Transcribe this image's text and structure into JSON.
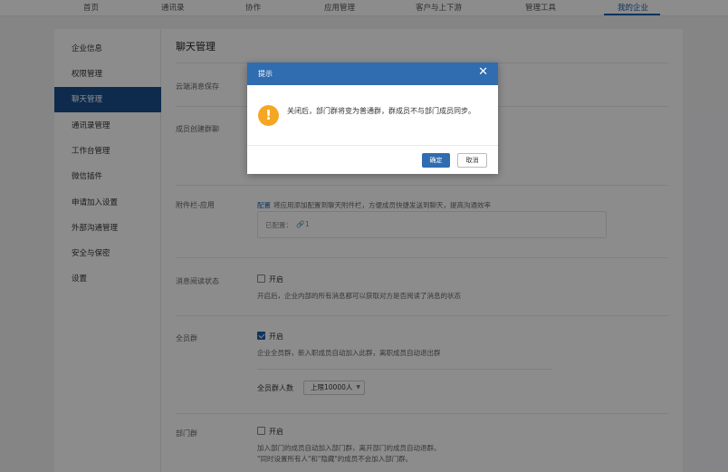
{
  "topnav": {
    "tabs": [
      {
        "label": "首页",
        "active": false
      },
      {
        "label": "通讯录",
        "active": false
      },
      {
        "label": "协作",
        "active": false
      },
      {
        "label": "应用管理",
        "active": false
      },
      {
        "label": "客户与上下游",
        "active": false
      },
      {
        "label": "管理工具",
        "active": false
      },
      {
        "label": "我的企业",
        "active": true
      }
    ]
  },
  "sidebar": {
    "items": [
      {
        "label": "企业信息",
        "active": false
      },
      {
        "label": "权限管理",
        "active": false
      },
      {
        "label": "聊天管理",
        "active": true
      },
      {
        "label": "通讯录管理",
        "active": false
      },
      {
        "label": "工作台管理",
        "active": false
      },
      {
        "label": "微信插件",
        "active": false
      },
      {
        "label": "申请加入设置",
        "active": false
      },
      {
        "label": "外部沟通管理",
        "active": false
      },
      {
        "label": "安全与保密",
        "active": false
      },
      {
        "label": "设置",
        "active": false
      }
    ]
  },
  "content": {
    "title": "聊天管理",
    "cloud_storage_label": "云端消息保存",
    "member_group_label": "成员创建群聊",
    "attachment": {
      "label": "附件栏-应用",
      "config_link": "配置",
      "description": "将应用添加配置到聊天附件栏，方便成员快捷发送到聊天，提高沟通效率",
      "configured_text": "已配置：",
      "configured_count": "1"
    },
    "read_status": {
      "label": "消息阅读状态",
      "checkbox_label": "开启",
      "checked": false,
      "description": "开启后，企业内部的所有消息都可以获取对方是否阅读了消息的状态"
    },
    "all_staff_group": {
      "label": "全员群",
      "checkbox_label": "开启",
      "checked": true,
      "description": "企业全员群，新入职成员自动加入此群，离职成员自动退出群",
      "count_label": "全员群人数",
      "count_value": "上限10000人"
    },
    "dept_group": {
      "label": "部门群",
      "checkbox_label": "开启",
      "checked": false,
      "description_line1": "加入部门的成员自动加入部门群，离开部门的成员自动退群。",
      "description_line2": "\"同时设置所有人\"和\"隐藏\"的成员不会加入部门群。"
    }
  },
  "dialog": {
    "title": "提示",
    "close_glyph": "✕",
    "warning_glyph": "!",
    "message": "关闭后，部门群将变为普通群，群成员不与部门成员同步。",
    "ok_label": "确定",
    "cancel_label": "取消"
  },
  "colors": {
    "accent": "#2f6cb0",
    "sidebar_active": "#1a4f8e",
    "warning": "#f5a623"
  }
}
